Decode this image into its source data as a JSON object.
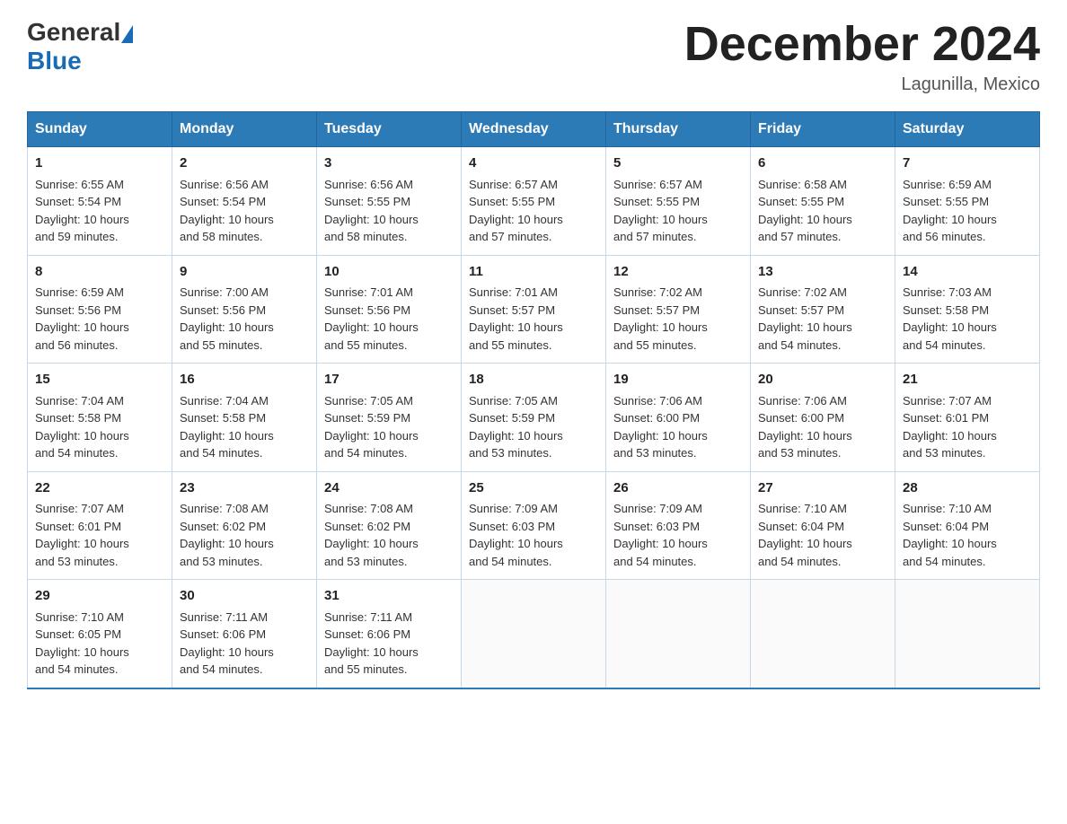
{
  "header": {
    "logo_general": "General",
    "logo_blue": "Blue",
    "title": "December 2024",
    "location": "Lagunilla, Mexico"
  },
  "weekdays": [
    "Sunday",
    "Monday",
    "Tuesday",
    "Wednesday",
    "Thursday",
    "Friday",
    "Saturday"
  ],
  "weeks": [
    [
      {
        "day": "1",
        "info": "Sunrise: 6:55 AM\nSunset: 5:54 PM\nDaylight: 10 hours\nand 59 minutes."
      },
      {
        "day": "2",
        "info": "Sunrise: 6:56 AM\nSunset: 5:54 PM\nDaylight: 10 hours\nand 58 minutes."
      },
      {
        "day": "3",
        "info": "Sunrise: 6:56 AM\nSunset: 5:55 PM\nDaylight: 10 hours\nand 58 minutes."
      },
      {
        "day": "4",
        "info": "Sunrise: 6:57 AM\nSunset: 5:55 PM\nDaylight: 10 hours\nand 57 minutes."
      },
      {
        "day": "5",
        "info": "Sunrise: 6:57 AM\nSunset: 5:55 PM\nDaylight: 10 hours\nand 57 minutes."
      },
      {
        "day": "6",
        "info": "Sunrise: 6:58 AM\nSunset: 5:55 PM\nDaylight: 10 hours\nand 57 minutes."
      },
      {
        "day": "7",
        "info": "Sunrise: 6:59 AM\nSunset: 5:55 PM\nDaylight: 10 hours\nand 56 minutes."
      }
    ],
    [
      {
        "day": "8",
        "info": "Sunrise: 6:59 AM\nSunset: 5:56 PM\nDaylight: 10 hours\nand 56 minutes."
      },
      {
        "day": "9",
        "info": "Sunrise: 7:00 AM\nSunset: 5:56 PM\nDaylight: 10 hours\nand 55 minutes."
      },
      {
        "day": "10",
        "info": "Sunrise: 7:01 AM\nSunset: 5:56 PM\nDaylight: 10 hours\nand 55 minutes."
      },
      {
        "day": "11",
        "info": "Sunrise: 7:01 AM\nSunset: 5:57 PM\nDaylight: 10 hours\nand 55 minutes."
      },
      {
        "day": "12",
        "info": "Sunrise: 7:02 AM\nSunset: 5:57 PM\nDaylight: 10 hours\nand 55 minutes."
      },
      {
        "day": "13",
        "info": "Sunrise: 7:02 AM\nSunset: 5:57 PM\nDaylight: 10 hours\nand 54 minutes."
      },
      {
        "day": "14",
        "info": "Sunrise: 7:03 AM\nSunset: 5:58 PM\nDaylight: 10 hours\nand 54 minutes."
      }
    ],
    [
      {
        "day": "15",
        "info": "Sunrise: 7:04 AM\nSunset: 5:58 PM\nDaylight: 10 hours\nand 54 minutes."
      },
      {
        "day": "16",
        "info": "Sunrise: 7:04 AM\nSunset: 5:58 PM\nDaylight: 10 hours\nand 54 minutes."
      },
      {
        "day": "17",
        "info": "Sunrise: 7:05 AM\nSunset: 5:59 PM\nDaylight: 10 hours\nand 54 minutes."
      },
      {
        "day": "18",
        "info": "Sunrise: 7:05 AM\nSunset: 5:59 PM\nDaylight: 10 hours\nand 53 minutes."
      },
      {
        "day": "19",
        "info": "Sunrise: 7:06 AM\nSunset: 6:00 PM\nDaylight: 10 hours\nand 53 minutes."
      },
      {
        "day": "20",
        "info": "Sunrise: 7:06 AM\nSunset: 6:00 PM\nDaylight: 10 hours\nand 53 minutes."
      },
      {
        "day": "21",
        "info": "Sunrise: 7:07 AM\nSunset: 6:01 PM\nDaylight: 10 hours\nand 53 minutes."
      }
    ],
    [
      {
        "day": "22",
        "info": "Sunrise: 7:07 AM\nSunset: 6:01 PM\nDaylight: 10 hours\nand 53 minutes."
      },
      {
        "day": "23",
        "info": "Sunrise: 7:08 AM\nSunset: 6:02 PM\nDaylight: 10 hours\nand 53 minutes."
      },
      {
        "day": "24",
        "info": "Sunrise: 7:08 AM\nSunset: 6:02 PM\nDaylight: 10 hours\nand 53 minutes."
      },
      {
        "day": "25",
        "info": "Sunrise: 7:09 AM\nSunset: 6:03 PM\nDaylight: 10 hours\nand 54 minutes."
      },
      {
        "day": "26",
        "info": "Sunrise: 7:09 AM\nSunset: 6:03 PM\nDaylight: 10 hours\nand 54 minutes."
      },
      {
        "day": "27",
        "info": "Sunrise: 7:10 AM\nSunset: 6:04 PM\nDaylight: 10 hours\nand 54 minutes."
      },
      {
        "day": "28",
        "info": "Sunrise: 7:10 AM\nSunset: 6:04 PM\nDaylight: 10 hours\nand 54 minutes."
      }
    ],
    [
      {
        "day": "29",
        "info": "Sunrise: 7:10 AM\nSunset: 6:05 PM\nDaylight: 10 hours\nand 54 minutes."
      },
      {
        "day": "30",
        "info": "Sunrise: 7:11 AM\nSunset: 6:06 PM\nDaylight: 10 hours\nand 54 minutes."
      },
      {
        "day": "31",
        "info": "Sunrise: 7:11 AM\nSunset: 6:06 PM\nDaylight: 10 hours\nand 55 minutes."
      },
      {
        "day": "",
        "info": ""
      },
      {
        "day": "",
        "info": ""
      },
      {
        "day": "",
        "info": ""
      },
      {
        "day": "",
        "info": ""
      }
    ]
  ]
}
